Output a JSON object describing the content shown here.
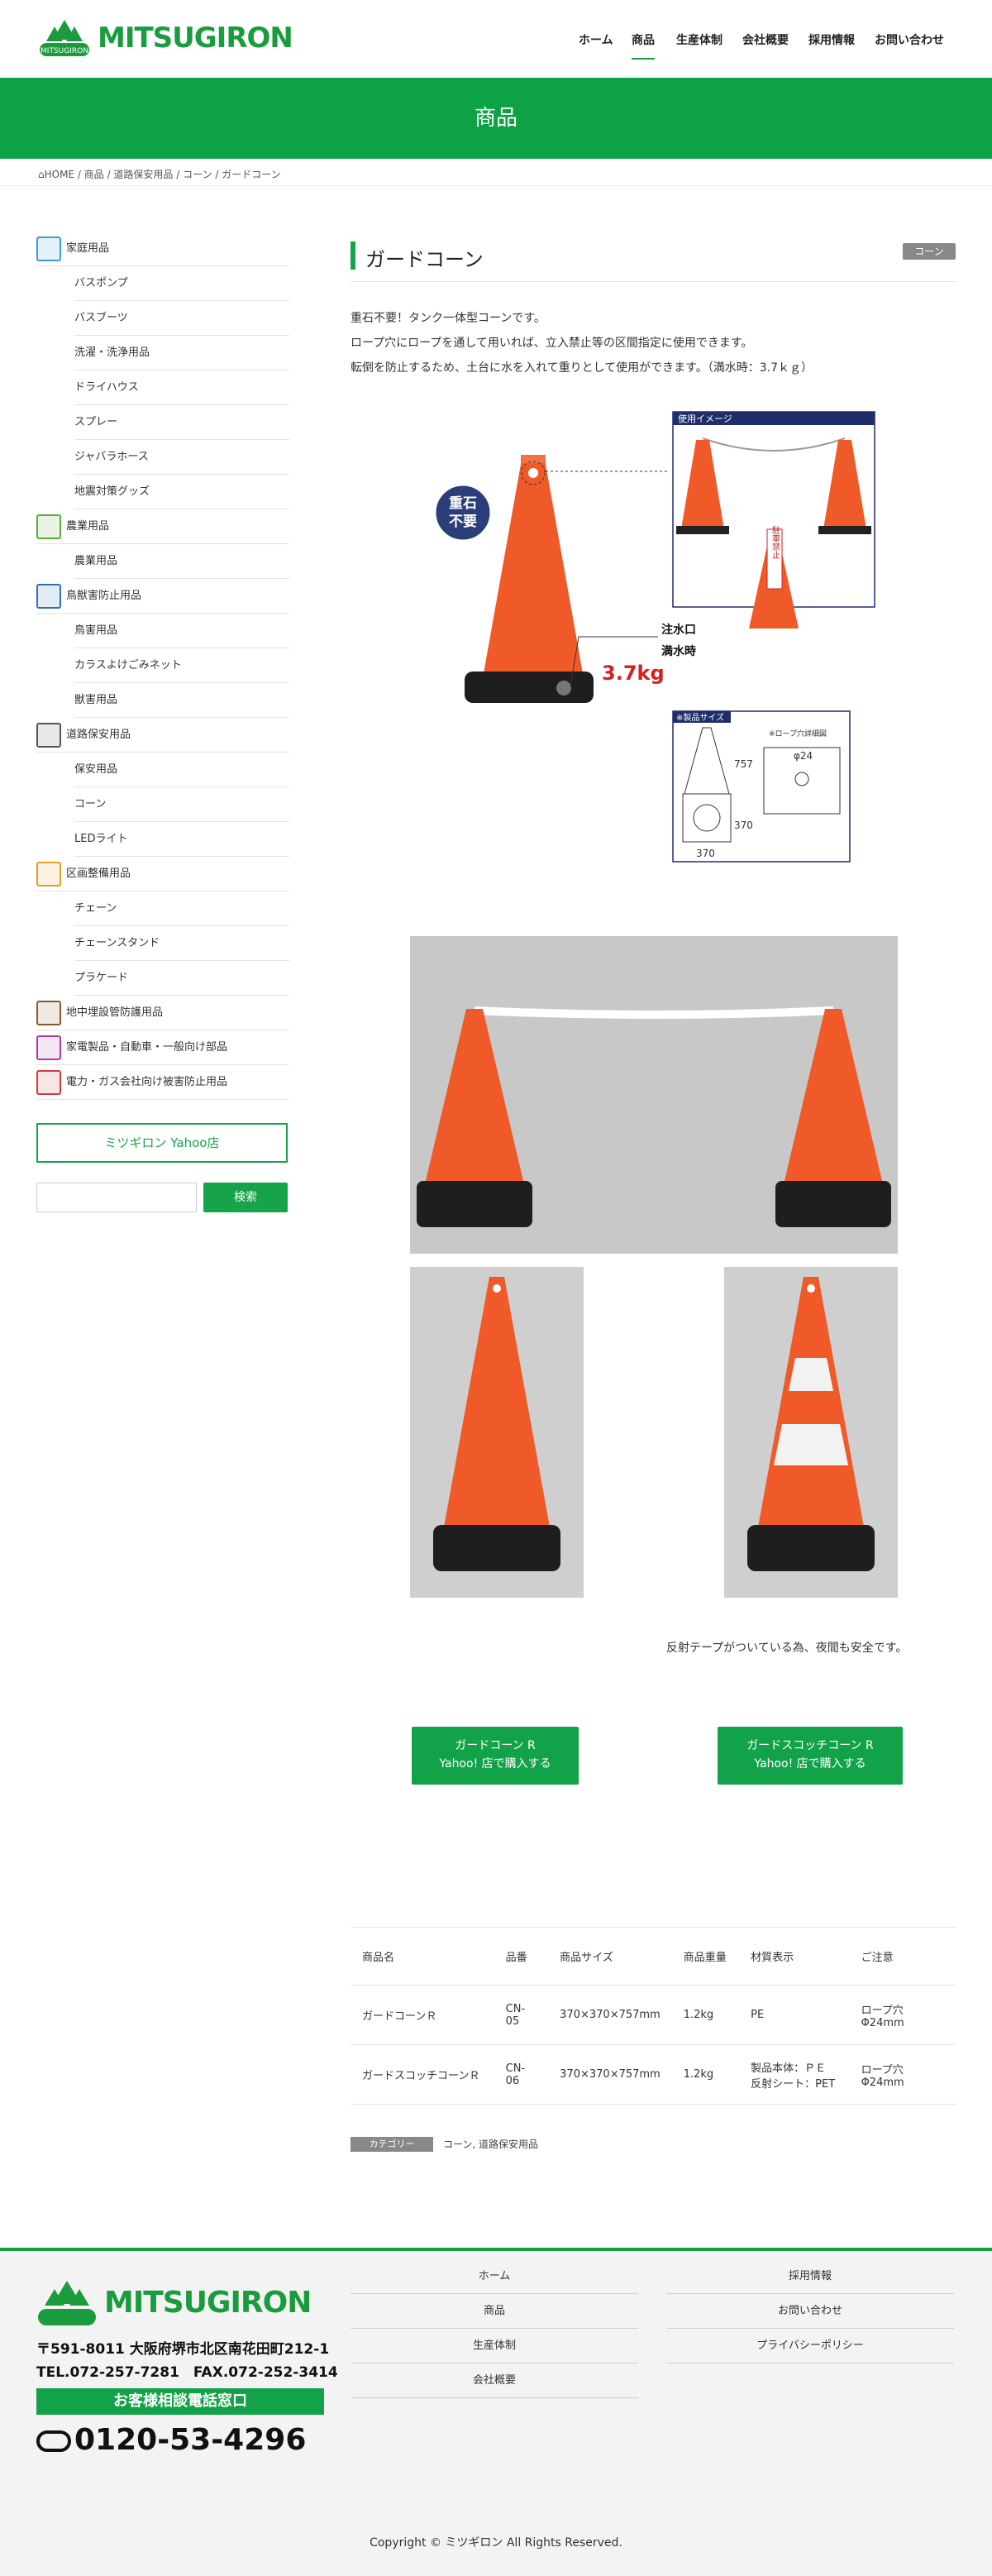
{
  "header": {
    "logo_small": "MITSUGIRON",
    "logo_word": "MITSUGIRON",
    "nav": [
      "ホーム",
      "商品",
      "生産体制",
      "会社概要",
      "採用情報",
      "お問い合わせ"
    ]
  },
  "banner": {
    "title": "商品"
  },
  "breadcrumb": [
    "HOME",
    "商品",
    "道路保安用品",
    "コーン",
    "ガードコーン"
  ],
  "sidebar": {
    "items": [
      {
        "label": "家庭用品",
        "type": "cat",
        "color": "#3a9bd5"
      },
      {
        "label": "バスポンプ",
        "type": "sub"
      },
      {
        "label": "バスブーツ",
        "type": "sub"
      },
      {
        "label": "洗濯・洗浄用品",
        "type": "sub"
      },
      {
        "label": "ドライハウス",
        "type": "sub"
      },
      {
        "label": "スプレー",
        "type": "sub"
      },
      {
        "label": "ジャバラホース",
        "type": "sub"
      },
      {
        "label": "地震対策グッズ",
        "type": "sub"
      },
      {
        "label": "農業用品",
        "type": "cat",
        "color": "#5aab3a"
      },
      {
        "label": "農業用品",
        "type": "sub"
      },
      {
        "label": "鳥獣害防止用品",
        "type": "cat",
        "color": "#2f6fb3"
      },
      {
        "label": "鳥害用品",
        "type": "sub"
      },
      {
        "label": "カラスよけごみネット",
        "type": "sub"
      },
      {
        "label": "獣害用品",
        "type": "sub"
      },
      {
        "label": "道路保安用品",
        "type": "cat",
        "color": "#555555"
      },
      {
        "label": "保安用品",
        "type": "sub"
      },
      {
        "label": "コーン",
        "type": "sub"
      },
      {
        "label": "LEDライト",
        "type": "sub"
      },
      {
        "label": "区画整備用品",
        "type": "cat",
        "color": "#e5a020"
      },
      {
        "label": "チェーン",
        "type": "sub"
      },
      {
        "label": "チェーンスタンド",
        "type": "sub"
      },
      {
        "label": "プラケード",
        "type": "sub"
      },
      {
        "label": "地中埋設管防護用品",
        "type": "cat",
        "color": "#8a5a2a"
      },
      {
        "label": "家電製品・自動車・一般向け部品",
        "type": "cat",
        "color": "#b03a9b"
      },
      {
        "label": "電力・ガス会社向け被害防止用品",
        "type": "cat",
        "color": "#d43a3a"
      }
    ],
    "yahoo_button": "ミツギロン Yahoo店",
    "search_button": "検索",
    "search_placeholder": ""
  },
  "main": {
    "title": "ガードコーン",
    "category_badge": "コーン",
    "description": [
      "重石不要！タンク一体型コーンです。",
      "ロープ穴にロープを通して用いれば、立入禁止等の区間指定に使用できます。",
      "転倒を防止するため、土台に水を入れて重りとして使用ができます。（満水時：3.7ｋｇ）"
    ],
    "diagram_labels": {
      "no_weight_1": "重石",
      "no_weight_2": "不要",
      "water_inlet": "注水口",
      "full": "満水時",
      "weight": "3.7kg",
      "usage": "使用イメージ",
      "no_parking": "駐車禁止",
      "size": "※製品サイズ",
      "hole_detail": "※ロープ穴詳細図",
      "hole_dim": "φ24",
      "dim_757": "757",
      "dim_370a": "370",
      "dim_370b": "370"
    },
    "reflective_note": "反射テープがついている為、夜間も安全です。",
    "buy_buttons": [
      [
        "ガードコーン R",
        "Yahoo! 店で購入する"
      ],
      [
        "ガードスコッチコーン R",
        "Yahoo! 店で購入する"
      ]
    ],
    "table": {
      "headers": [
        "商品名",
        "品番",
        "商品サイズ",
        "商品重量",
        "材質表示",
        "ご注意"
      ],
      "rows": [
        [
          "ガードコーンＲ",
          "CN-05",
          "370×370×757mm",
          "1.2kg",
          "PE",
          "ロープ穴Φ24mm"
        ],
        [
          "ガードスコッチコーンＲ",
          "CN-06",
          "370×370×757mm",
          "1.2kg",
          "製品本体：ＰＥ 反射シート：PET",
          "ロープ穴Φ24mm"
        ]
      ]
    },
    "category_label": "カテゴリー",
    "category_value": "コーン, 道路保安用品"
  },
  "footer": {
    "logo_word": "MITSUGIRON",
    "address": "〒591-8011 大阪府堺市北区南花田町212-1",
    "tel": "TEL.072-257-7281　FAX.072-252-3414",
    "consult": "お客様相談電話窓口",
    "freedial": "0120-53-4296",
    "nav_left": [
      "ホーム",
      "商品",
      "生産体制",
      "会社概要"
    ],
    "nav_right": [
      "採用情報",
      "お問い合わせ",
      "プライバシーポリシー"
    ],
    "copyright": "Copyright © ミツギロン All Rights Reserved."
  }
}
